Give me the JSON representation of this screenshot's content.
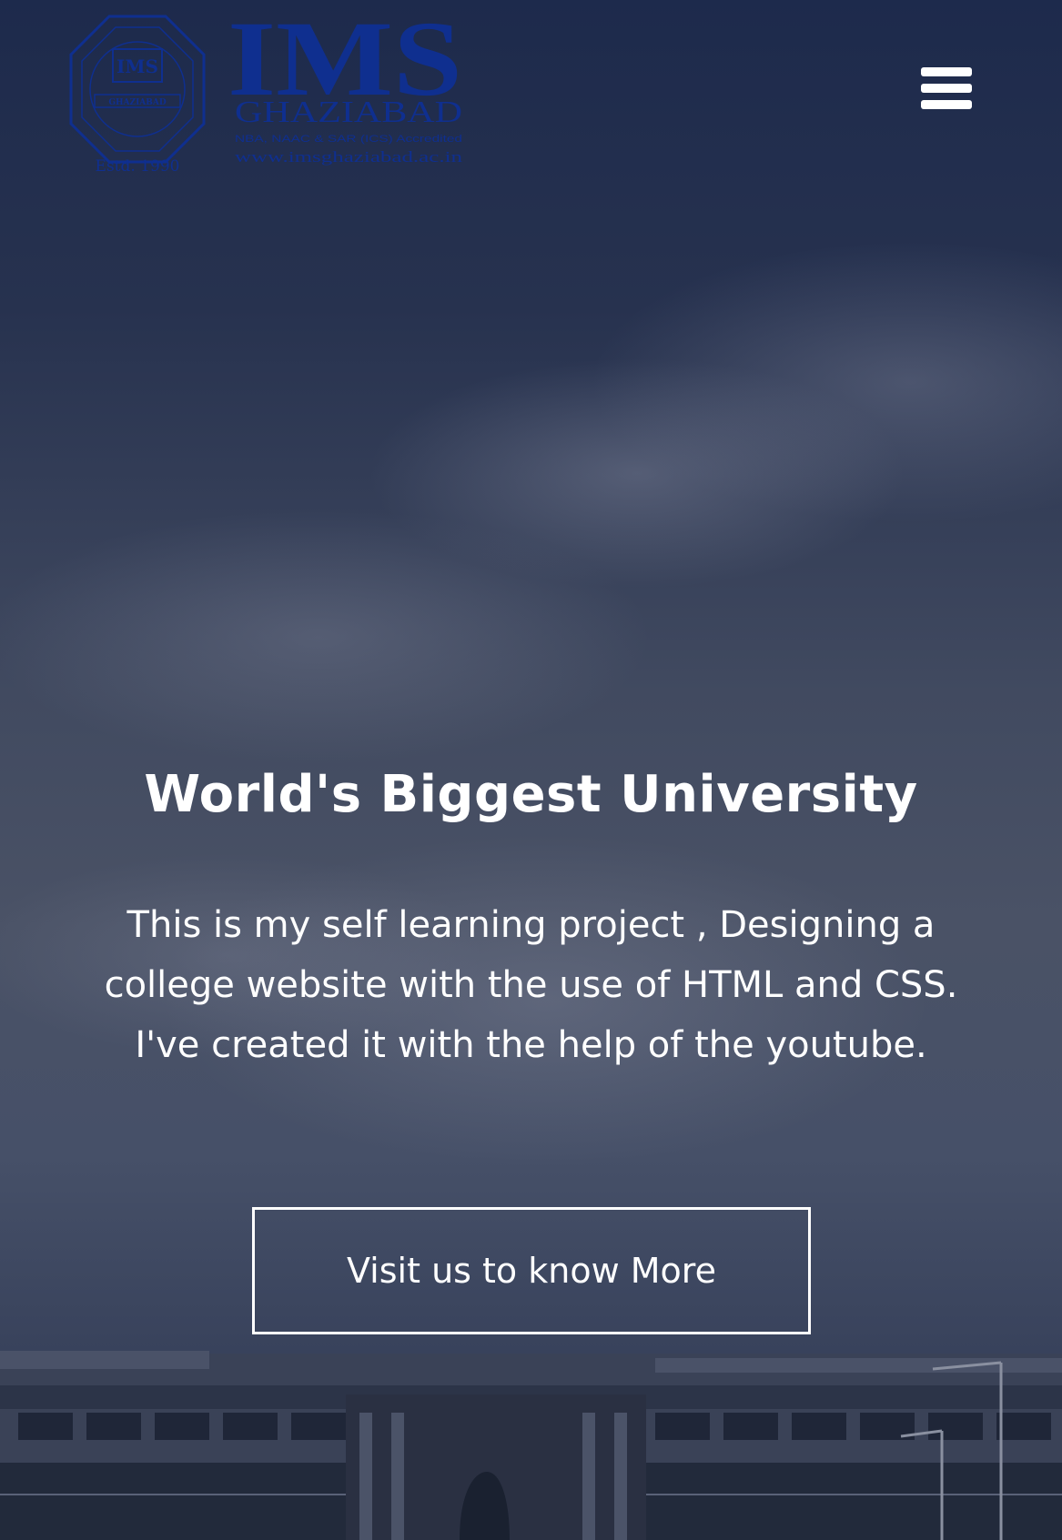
{
  "header": {
    "logo": {
      "brand": "IMS",
      "city": "GHAZIABAD",
      "tagline": "NBA, NAAC & SAR (ICS) Accredited",
      "website": "www.imsghaziabad.ac.in",
      "seal_text": "IMS",
      "seal_ring_text": "INSTITUTE OF MANAGEMENT STUDIES",
      "seal_banner": "GHAZIABAD",
      "estd": "Estd. 1990",
      "color": "#0f2f8f"
    },
    "menu_icon": "hamburger-menu-icon"
  },
  "hero": {
    "title": "World's Biggest University",
    "description": "This is my self learning project , Designing a college website with the use of HTML and CSS. I've created it with the help of the youtube.",
    "cta_label": "Visit us to know More"
  },
  "colors": {
    "text": "#ffffff",
    "overlay": "#1d2a4c",
    "logo": "#0f2f8f"
  }
}
